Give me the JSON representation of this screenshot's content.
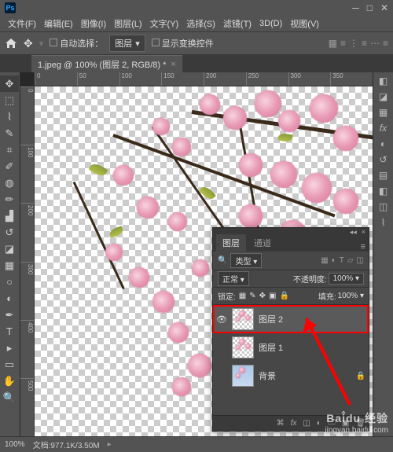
{
  "app": {
    "name": "Ps"
  },
  "menu": {
    "file": "文件(F)",
    "edit": "编辑(E)",
    "image": "图像(I)",
    "layer": "图层(L)",
    "type": "文字(Y)",
    "select": "选择(S)",
    "filter": "滤镜(T)",
    "3d": "3D(D)",
    "view": "视图(V)"
  },
  "options": {
    "auto_select": "自动选择：",
    "target": "图层",
    "show_transform": "显示变换控件"
  },
  "tab": {
    "title": "1.jpeg @ 100% (图层 2, RGB/8) *"
  },
  "ruler_h": [
    "0",
    "50",
    "100",
    "150",
    "200",
    "250",
    "300",
    "350"
  ],
  "ruler_v": [
    "0",
    "100",
    "200",
    "300",
    "400",
    "500"
  ],
  "status": {
    "zoom": "100%",
    "doc": "文档:977.1K/3.50M"
  },
  "panel": {
    "tab_layers": "图层",
    "tab_channels": "通道",
    "filter_kind": "类型",
    "blend_mode": "正常",
    "opacity_label": "不透明度:",
    "opacity_value": "100%",
    "lock_label": "锁定:",
    "fill_label": "填充:",
    "fill_value": "100%",
    "layers": [
      {
        "name": "图层 2",
        "visible": true,
        "selected": true,
        "locked": false,
        "bg": false
      },
      {
        "name": "图层 1",
        "visible": false,
        "selected": false,
        "locked": false,
        "bg": false
      },
      {
        "name": "背景",
        "visible": false,
        "selected": false,
        "locked": true,
        "bg": true
      }
    ]
  },
  "watermark": {
    "brand": "Bai̐du 经验",
    "url": "jingyan.baidu.com"
  }
}
